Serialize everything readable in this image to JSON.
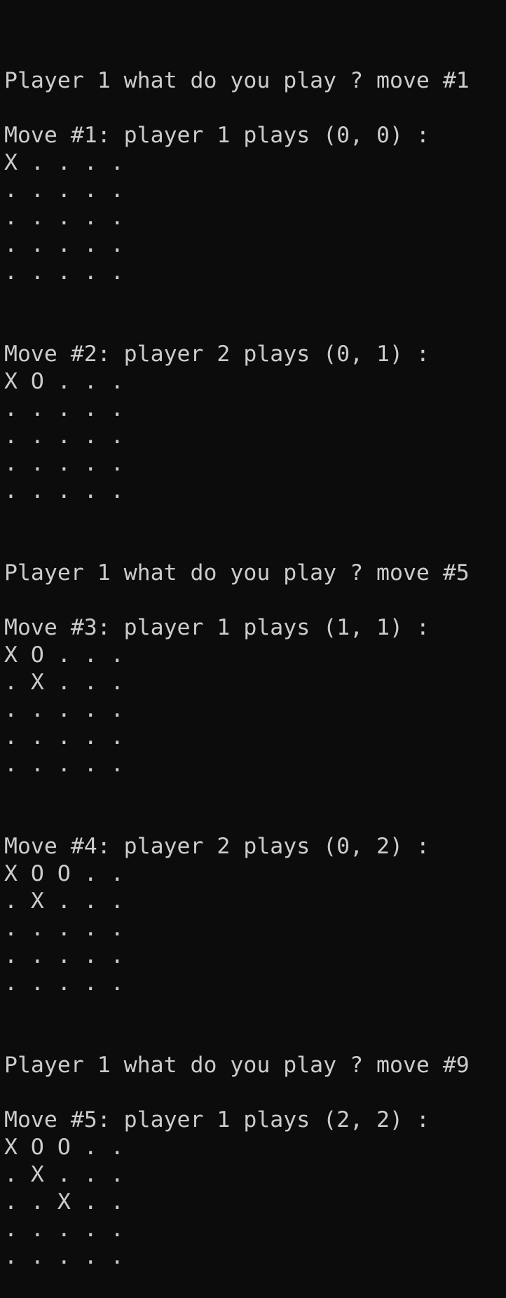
{
  "terminal": {
    "lines": [
      "Player 1 what do you play ? move #1",
      "",
      "Move #1: player 1 plays (0, 0) :",
      "X . . . .",
      ". . . . .",
      ". . . . .",
      ". . . . .",
      ". . . . .",
      "",
      "",
      "Move #2: player 2 plays (0, 1) :",
      "X O . . .",
      ". . . . .",
      ". . . . .",
      ". . . . .",
      ". . . . .",
      "",
      "",
      "Player 1 what do you play ? move #5",
      "",
      "Move #3: player 1 plays (1, 1) :",
      "X O . . .",
      ". X . . .",
      ". . . . .",
      ". . . . .",
      ". . . . .",
      "",
      "",
      "Move #4: player 2 plays (0, 2) :",
      "X O O . .",
      ". X . . .",
      ". . . . .",
      ". . . . .",
      ". . . . .",
      "",
      "",
      "Player 1 what do you play ? move #9",
      "",
      "Move #5: player 1 plays (2, 2) :",
      "X O O . .",
      ". X . . .",
      ". . X . .",
      ". . . . .",
      ". . . . ."
    ]
  }
}
